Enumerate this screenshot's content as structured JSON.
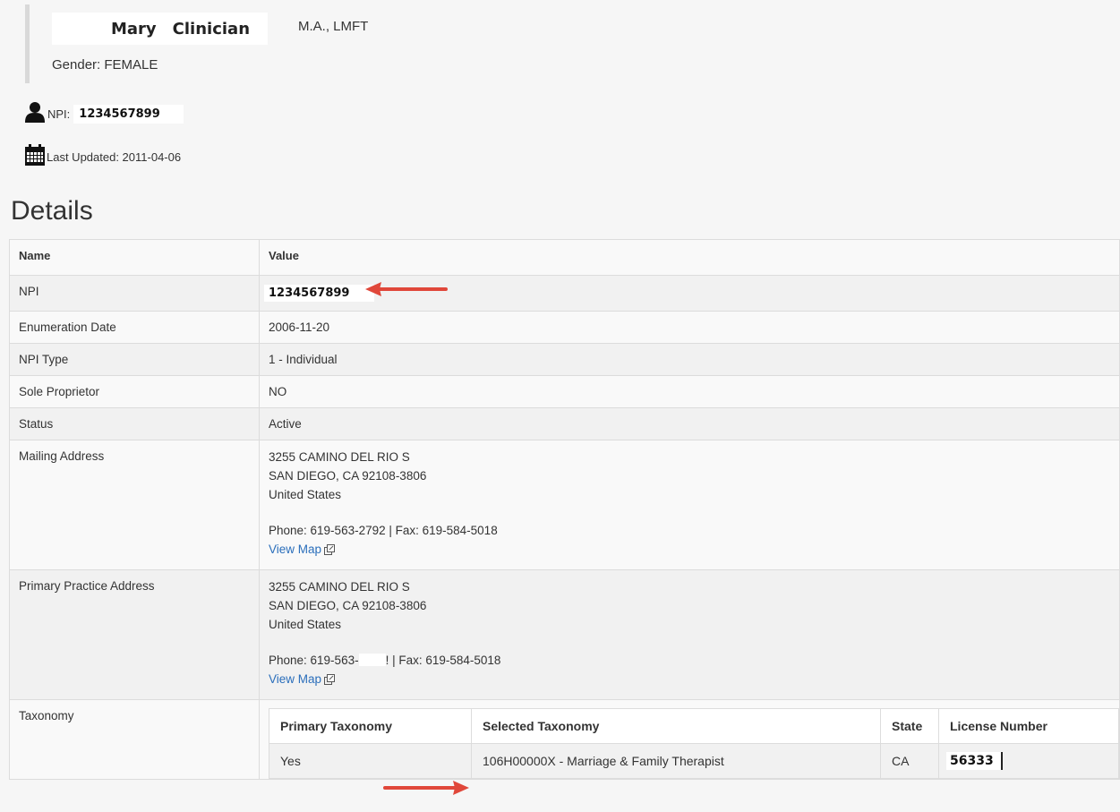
{
  "provider": {
    "first_name": "Mary",
    "last_name": "Clinician",
    "credentials": "M.A., LMFT",
    "gender": "Gender: FEMALE",
    "npi_label": "NPI:",
    "npi": "1234567899",
    "last_updated": "Last Updated: 2011-04-06"
  },
  "icons": {
    "person": "person-icon",
    "calendar": "calendar-icon",
    "external_link": "external-link-icon",
    "arrow": "red-arrow-icon"
  },
  "colors": {
    "arrow": "#e0473a",
    "link": "#2a6ebb"
  },
  "details": {
    "heading": "Details",
    "col_name": "Name",
    "col_value": "Value",
    "rows": {
      "npi": {
        "name": "NPI",
        "value": "1234567899"
      },
      "enumeration": {
        "name": "Enumeration Date",
        "value": "2006-11-20"
      },
      "npi_type": {
        "name": "NPI Type",
        "value": "1 - Individual"
      },
      "sole": {
        "name": "Sole Proprietor",
        "value": "NO"
      },
      "status": {
        "name": "Status",
        "value": "Active"
      },
      "mailing": {
        "name": "Mailing Address",
        "line1": "3255 CAMINO DEL RIO S",
        "line2": "SAN DIEGO, CA 92108-3806",
        "line3": "United States",
        "phone": "Phone: 619-563-2792 | Fax: 619-584-5018",
        "map_link": "View Map"
      },
      "practice": {
        "name": "Primary Practice Address",
        "line1": "3255 CAMINO DEL RIO S",
        "line2": "SAN DIEGO, CA 92108-3806",
        "line3": "United States",
        "phone_prefix": "Phone: 619-563-",
        "phone_suffix": "! | Fax: 619-584-5018",
        "map_link": "View Map"
      },
      "taxonomy": {
        "name": "Taxonomy",
        "headers": {
          "primary": "Primary Taxonomy",
          "selected": "Selected Taxonomy",
          "state": "State",
          "license": "License Number"
        },
        "row": {
          "primary": "Yes",
          "selected": "106H00000X - Marriage & Family Therapist",
          "state": "CA",
          "license": "56333"
        }
      }
    }
  }
}
